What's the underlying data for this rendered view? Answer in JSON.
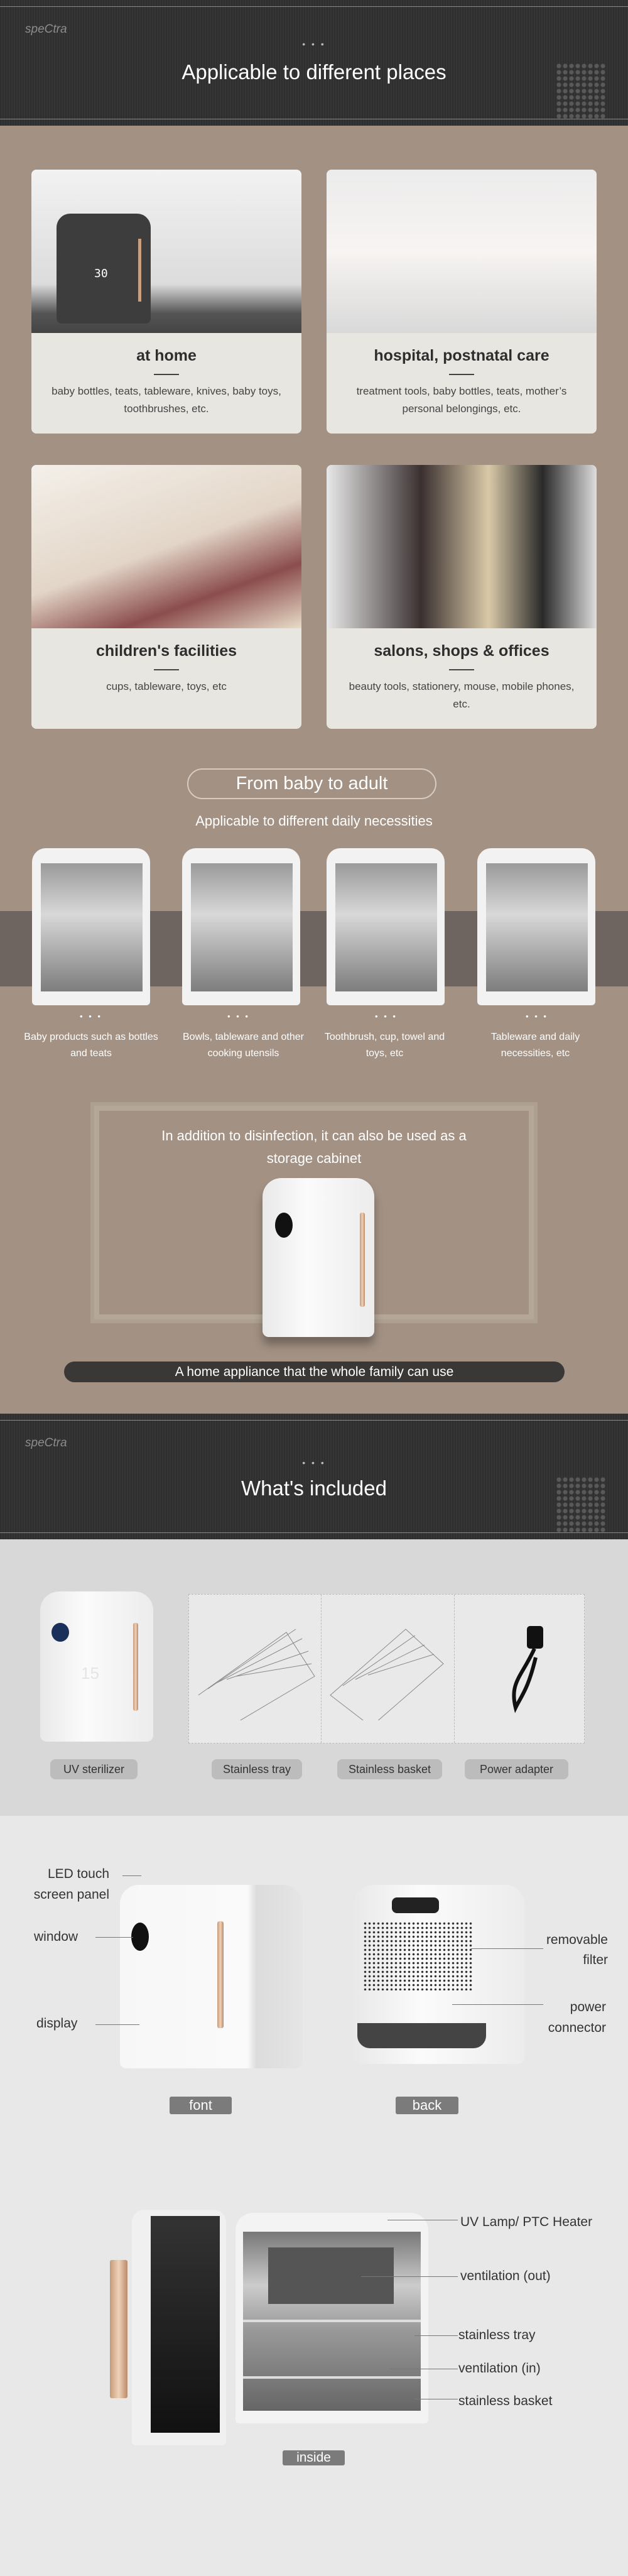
{
  "brand": "speCtra",
  "section1": {
    "dots": "• • •",
    "title": "Applicable to different places"
  },
  "places": [
    {
      "title": "at home",
      "desc": "baby bottles, teats, tableware, knives, baby toys, toothbrushes, etc.",
      "display": "30"
    },
    {
      "title": "hospital, postnatal care",
      "desc": "treatment tools, baby bottles, teats, mother’s personal belongings, etc."
    },
    {
      "title": "children's facilities",
      "desc": "cups, tableware, toys, etc"
    },
    {
      "title": "salons, shops & offices",
      "desc": "beauty tools, stationery, mouse, mobile phones, etc."
    }
  ],
  "necessities": {
    "pill": "From baby to adult",
    "subtitle": "Applicable to different daily necessities",
    "dots": "• • •",
    "items": [
      "Baby products such as bottles and teats",
      "Bowls, tableware and other cooking utensils",
      "Toothbrush, cup, towel and toys, etc",
      "Tableware and daily necessities, etc"
    ]
  },
  "storage": {
    "text": "In addition to disinfection, it can also be used as a storage cabinet",
    "banner": "A home appliance that the whole family can use"
  },
  "section2": {
    "dots": "• • •",
    "title": "What's included"
  },
  "included": [
    "UV sterilizer",
    "Stainless tray",
    "Stainless basket",
    "Power adapter"
  ],
  "included_display": "15",
  "front_back": {
    "led": "LED touch",
    "led2": "screen panel",
    "window": "window",
    "display": "display",
    "filter": "removable",
    "filter2": "filter",
    "power": "power",
    "power2": "connector",
    "front_btn": "font",
    "back_btn": "back"
  },
  "inside": {
    "uv": "UV Lamp/ PTC Heater",
    "vent_out": "ventilation (out)",
    "tray": "stainless tray",
    "vent_in": "ventilation (in)",
    "basket": "stainless basket",
    "btn": "inside"
  },
  "colors": {
    "header": "#333333",
    "brown": "#a39184",
    "band": "#6f6560",
    "banner": "#3a3836",
    "light": "#d8d8d8"
  }
}
